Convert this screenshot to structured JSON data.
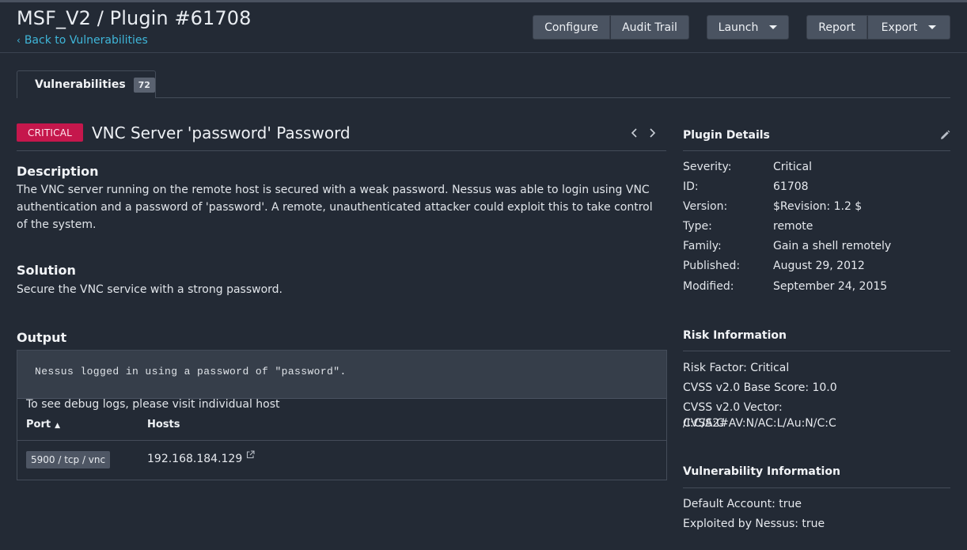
{
  "header": {
    "title": "MSF_V2 / Plugin #61708",
    "back_link": "Back to Vulnerabilities",
    "buttons": {
      "configure": "Configure",
      "audit_trail": "Audit Trail",
      "launch": "Launch",
      "report": "Report",
      "export": "Export"
    }
  },
  "tabs": [
    {
      "label": "Vulnerabilities",
      "count": "72"
    }
  ],
  "vulnerability": {
    "severity_badge": "CRITICAL",
    "title": "VNC Server 'password' Password",
    "description_heading": "Description",
    "description": "The VNC server running on the remote host is secured with a weak password. Nessus was able to login using VNC authentication and a password of 'password'. A remote, unauthenticated attacker could exploit this to take control of the system.",
    "solution_heading": "Solution",
    "solution": "Secure the VNC service with a strong password.",
    "output_heading": "Output",
    "output_text": "Nessus logged in using a password of \"password\".",
    "debug_note": "To see debug logs, please visit individual host",
    "table": {
      "columns": [
        "Port",
        "Hosts"
      ],
      "sort_indicator": "▲",
      "rows": [
        {
          "port": "5900 / tcp / vnc",
          "host": "192.168.184.129"
        }
      ]
    }
  },
  "plugin_details": {
    "heading": "Plugin Details",
    "rows": [
      {
        "key": "Severity:",
        "value": "Critical"
      },
      {
        "key": "ID:",
        "value": "61708"
      },
      {
        "key": "Version:",
        "value": "$Revision: 1.2 $"
      },
      {
        "key": "Type:",
        "value": "remote"
      },
      {
        "key": "Family:",
        "value": "Gain a shell remotely"
      },
      {
        "key": "Published:",
        "value": "August 29, 2012"
      },
      {
        "key": "Modified:",
        "value": "September 24, 2015"
      }
    ]
  },
  "risk_information": {
    "heading": "Risk Information",
    "risk_factor": "Risk Factor: Critical",
    "cvss_base": "CVSS v2.0 Base Score: 10.0",
    "cvss_vector_line1": "CVSS v2.0 Vector: CVSS2#AV:N/AC:L/Au:N/C:C",
    "cvss_vector_line2": "/I:C/A:C"
  },
  "vulnerability_information": {
    "heading": "Vulnerability Information",
    "default_account": "Default Account: true",
    "exploited_by_nessus": "Exploited by Nessus: true"
  },
  "colors": {
    "background": "#232a35",
    "accent_link": "#3fb6d9",
    "critical": "#c5174c",
    "button": "#4a5361"
  },
  "icons": {
    "back": "chevron-left-icon",
    "prev": "chevron-left-icon",
    "next": "chevron-right-icon",
    "dropdown": "caret-down-icon",
    "external_link": "external-link-icon",
    "edit": "pencil-icon"
  }
}
